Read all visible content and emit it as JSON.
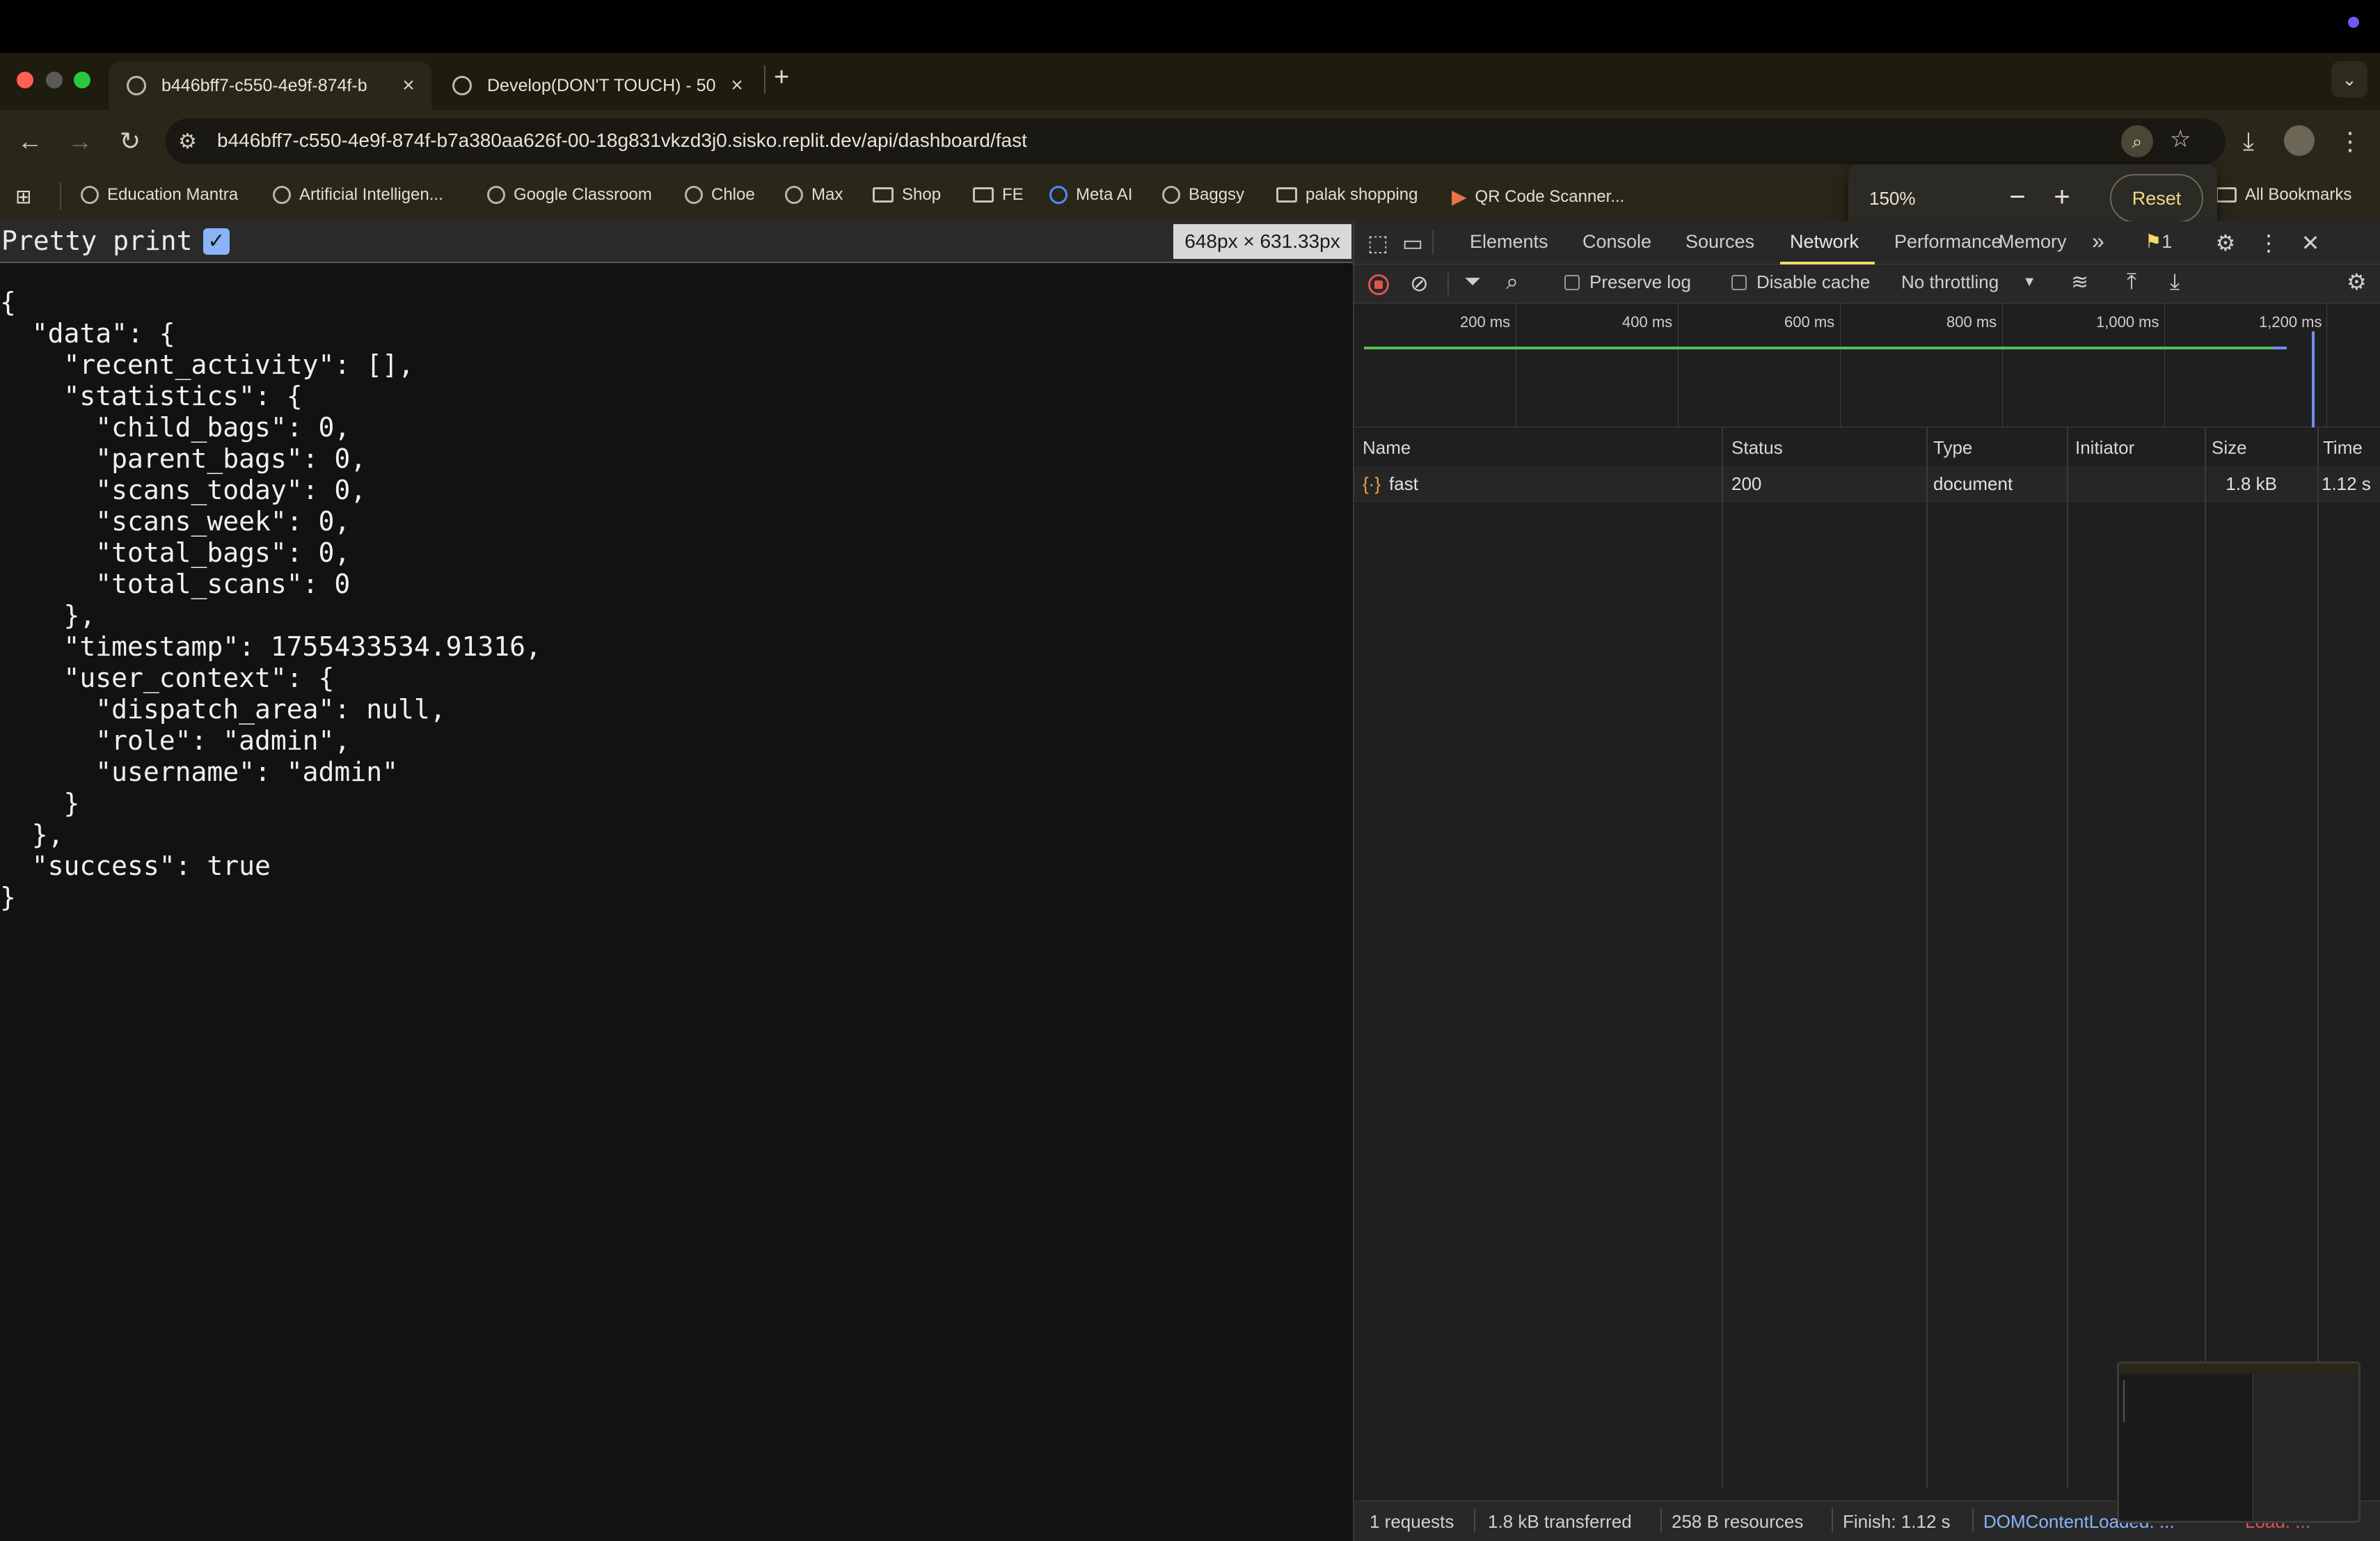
{
  "browser": {
    "tabs": [
      {
        "title": "b446bff7-c550-4e9f-874f-b",
        "active": true
      },
      {
        "title": "Develop(DON'T TOUCH) - 50",
        "active": false
      }
    ],
    "new_tab": "+",
    "tab_close": "×",
    "url": "b446bff7-c550-4e9f-874f-b7a380aa626f-00-18g831vkzd3j0.sisko.replit.dev/api/dashboard/fast",
    "bookmarks": [
      {
        "label": "Education Mantra",
        "icon": "globe-icon"
      },
      {
        "label": "Artificial Intelligen...",
        "icon": "globe-icon"
      },
      {
        "label": "Google Classroom",
        "icon": "globe-icon"
      },
      {
        "label": "Chloe",
        "icon": "globe-icon"
      },
      {
        "label": "Max",
        "icon": "globe-icon"
      },
      {
        "label": "Shop",
        "icon": "folder-icon"
      },
      {
        "label": "FE",
        "icon": "folder-icon"
      },
      {
        "label": "Meta AI",
        "icon": "meta-icon"
      },
      {
        "label": "Baggsy",
        "icon": "globe-icon"
      },
      {
        "label": "palak shopping",
        "icon": "folder-icon"
      },
      {
        "label": "QR Code Scanner...",
        "icon": "play-icon"
      }
    ],
    "all_bookmarks": "All Bookmarks",
    "zoom": {
      "level": "150%",
      "minus": "−",
      "plus": "+",
      "reset": "Reset"
    }
  },
  "page": {
    "pretty_print_label": "Pretty print",
    "pretty_print_checked": true,
    "dimensions_badge": "648px × 631.33px",
    "json_text": "{\n  \"data\": {\n    \"recent_activity\": [],\n    \"statistics\": {\n      \"child_bags\": 0,\n      \"parent_bags\": 0,\n      \"scans_today\": 0,\n      \"scans_week\": 0,\n      \"total_bags\": 0,\n      \"total_scans\": 0\n    },\n    \"timestamp\": 1755433534.91316,\n    \"user_context\": {\n      \"dispatch_area\": null,\n      \"role\": \"admin\",\n      \"username\": \"admin\"\n    }\n  },\n  \"success\": true\n}"
  },
  "devtools": {
    "tabs": [
      "Elements",
      "Console",
      "Sources",
      "Network",
      "Performance",
      "Memory"
    ],
    "active_tab": "Network",
    "more_tabs": "»",
    "issues_count": "1",
    "toolbar": {
      "preserve_log": "Preserve log",
      "disable_cache": "Disable cache",
      "throttling": "No throttling"
    },
    "timeline_labels": [
      "200 ms",
      "400 ms",
      "600 ms",
      "800 ms",
      "1,000 ms",
      "1,200 ms"
    ],
    "columns": [
      "Name",
      "Status",
      "Type",
      "Initiator",
      "Size",
      "Time"
    ],
    "rows": [
      {
        "name": "fast",
        "status": "200",
        "type": "document",
        "initiator": "",
        "size": "1.8 kB",
        "time": "1.12 s"
      }
    ],
    "status_bar": {
      "requests": "1 requests",
      "transferred": "1.8 kB transferred",
      "resources": "258 B resources",
      "finish": "Finish: 1.12 s",
      "dom_content": "DOMContentLoaded: ...",
      "load": "Load: ..."
    },
    "colors": {
      "active_underline": "#f5d76e",
      "record": "#e05252",
      "link": "#8ab4f8"
    }
  }
}
